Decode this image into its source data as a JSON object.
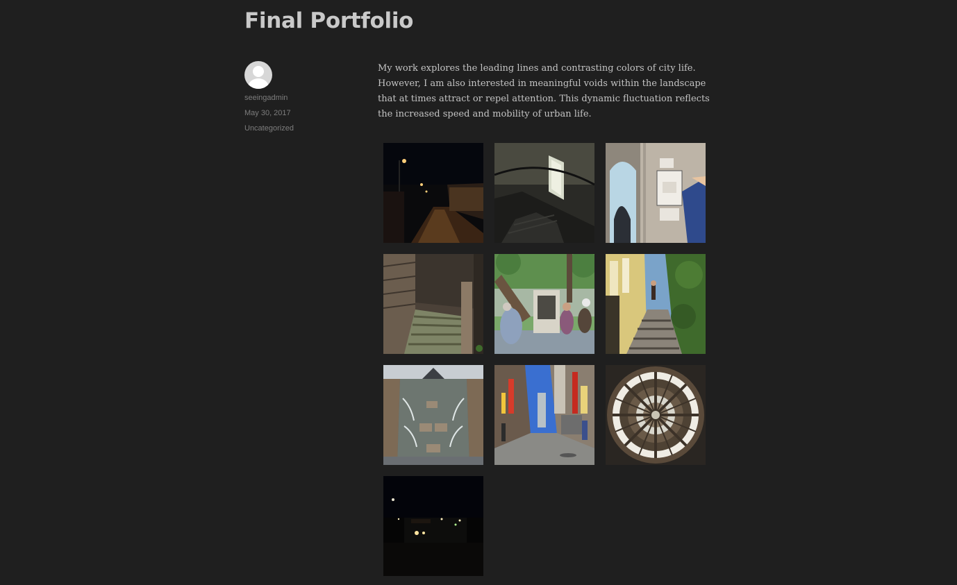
{
  "post": {
    "title": "Final Portfolio",
    "author": "seeingadmin",
    "date": "May 30, 2017",
    "category": "Uncategorized",
    "body": "My work explores the leading lines and contrasting colors of city life. However, I am also interested in meaningful voids within the landscape that at times attract or repel attention. This dynamic fluctuation reflects the increased speed and mobility of urban life."
  },
  "gallery": {
    "thumbnails": [
      {
        "subject": "night-street-photo"
      },
      {
        "subject": "dark-stairwell-photo"
      },
      {
        "subject": "stair-tower-sign-photo"
      },
      {
        "subject": "wooden-stairs-photo"
      },
      {
        "subject": "park-bench-people-photo"
      },
      {
        "subject": "outdoor-staircase-photo"
      },
      {
        "subject": "fountain-water-photo"
      },
      {
        "subject": "chinatown-street-photo"
      },
      {
        "subject": "dome-ceiling-photo"
      },
      {
        "subject": "night-lights-photo"
      }
    ]
  },
  "colors": {
    "background": "#1f1f1f",
    "title": "#c9c9c9",
    "meta": "#7d7d7d",
    "body_text": "#c4c4c4"
  }
}
